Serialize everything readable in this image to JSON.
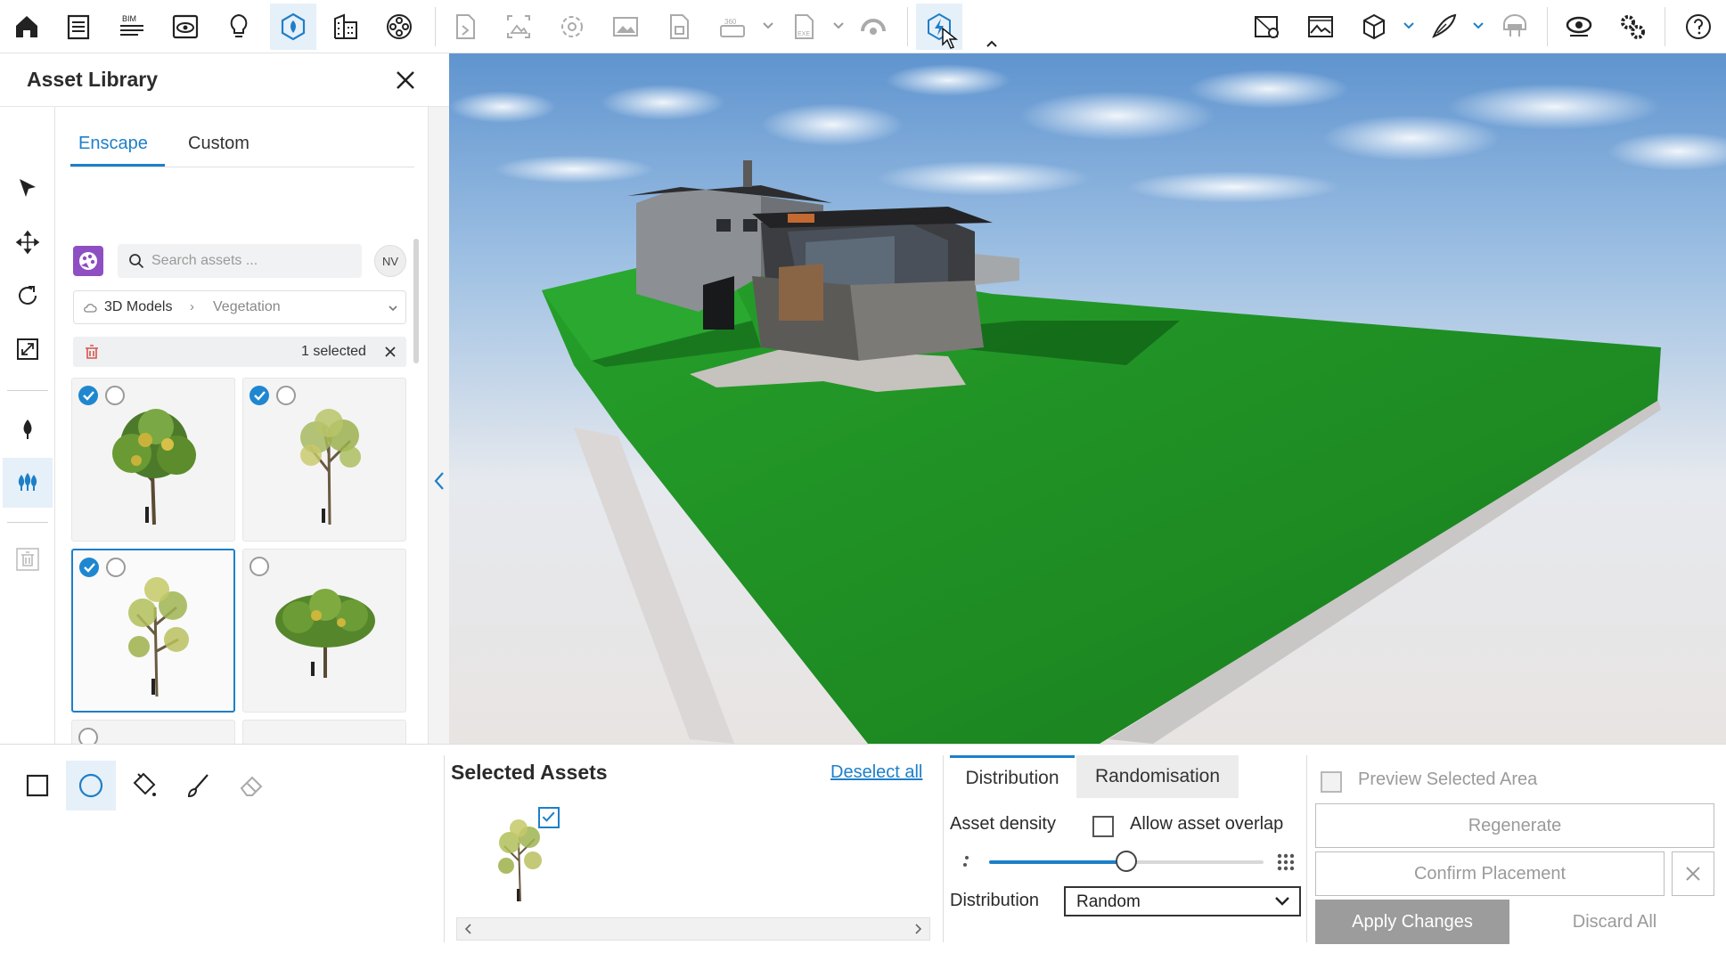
{
  "panel": {
    "title": "Asset Library",
    "tabs": [
      "Enscape",
      "Custom"
    ],
    "search_placeholder": "Search assets ...",
    "user_initials": "NV",
    "breadcrumb": [
      "3D Models",
      "Vegetation"
    ],
    "selection_count": "1 selected"
  },
  "selected_assets": {
    "title": "Selected Assets",
    "deselect_label": "Deselect all"
  },
  "distribution_panel": {
    "tabs": [
      "Distribution",
      "Randomisation"
    ],
    "asset_density_label": "Asset density",
    "allow_overlap_label": "Allow asset overlap",
    "density_level_percent": 50,
    "distribution_label": "Distribution",
    "distribution_value": "Random"
  },
  "actions": {
    "preview_label": "Preview Selected Area",
    "regenerate_label": "Regenerate",
    "confirm_label": "Confirm Placement",
    "apply_label": "Apply Changes",
    "discard_label": "Discard All"
  },
  "colors": {
    "accent": "#1e7fc8",
    "grass": "#1f8a24",
    "sky_top": "#5f94cf"
  }
}
